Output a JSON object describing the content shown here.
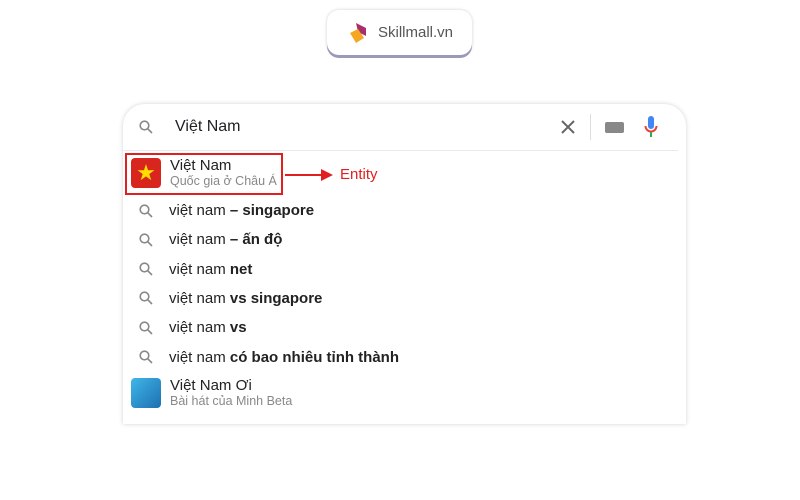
{
  "logo": {
    "text": "Skillmall.vn"
  },
  "search": {
    "query": "Việt Nam",
    "icons": [
      "search-icon",
      "clear-icon",
      "keyboard-icon",
      "mic-icon"
    ]
  },
  "entity_top": {
    "title": "Việt Nam",
    "subtitle": "Quốc gia ở Châu Á"
  },
  "annotation": {
    "label": "Entity",
    "color": "#e02020"
  },
  "suggestions": [
    {
      "prefix": "việt nam ",
      "bold": "– singapore"
    },
    {
      "prefix": "việt nam ",
      "bold": "– ấn độ"
    },
    {
      "prefix": "việt nam ",
      "bold": "net"
    },
    {
      "prefix": "việt nam ",
      "bold": "vs singapore"
    },
    {
      "prefix": "việt nam ",
      "bold": "vs"
    },
    {
      "prefix": "việt nam ",
      "bold": "có bao nhiêu tỉnh thành"
    }
  ],
  "entity_bottom": {
    "title": "Việt Nam Ơi",
    "subtitle": "Bài hát của Minh Beta"
  }
}
